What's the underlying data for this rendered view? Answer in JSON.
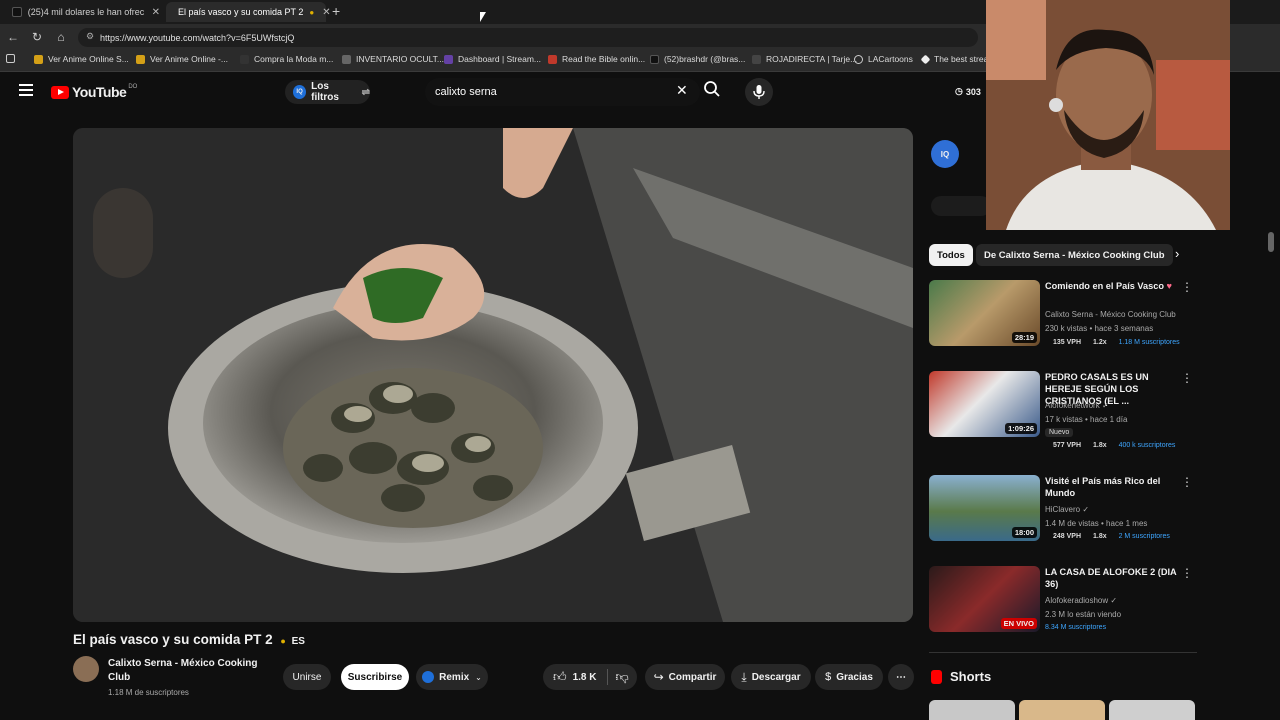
{
  "browser": {
    "tabs": [
      {
        "label": "(25)4 mil dolares le han ofrecido",
        "active": false
      },
      {
        "label": "El país vasco y su comida PT 2",
        "active": true
      }
    ],
    "url": "https://www.youtube.com/watch?v=6F5UWfstcjQ",
    "bookmarks": [
      "Ver Anime Online S...",
      "Ver Anime Online -...",
      "Compra la Moda m...",
      "INVENTARIO OCULT...",
      "Dashboard | Stream...",
      "Read the Bible onlin...",
      "(52)brashdr (@bras...",
      "ROJADIRECTA | Tarje...",
      "LACartoons",
      "The best strea"
    ]
  },
  "youtube": {
    "logo_text": "YouTube",
    "logo_sup": "DO",
    "filters_label": "Los filtros",
    "search_value": "calixto serna",
    "counter": "303"
  },
  "video": {
    "title": "El país vasco y su comida PT 2",
    "lang": "ES",
    "channel": "Calixto Serna - México Cooking Club",
    "subscribers": "1.18 M de suscriptores",
    "join_label": "Unirse",
    "subscribe_label": "Suscribirse",
    "remix_label": "Remix",
    "likes": "1.8 K",
    "share_label": "Compartir",
    "download_label": "Descargar",
    "thanks_label": "Gracias"
  },
  "sidebar": {
    "chips": [
      "Todos",
      "De Calixto Serna - México Cooking Club"
    ],
    "cards": [
      {
        "title": "Comiendo en el País Vasco",
        "channel": "Calixto Serna - México Cooking Club",
        "views": "230 k vistas • hace 3 semanas",
        "duration": "28:19",
        "vph": "135 VPH",
        "mult": "1.2x",
        "subs": "1.18 M suscriptores",
        "badge": ""
      },
      {
        "title": "PEDRO CASALS ES UN HEREJE SEGÚN LOS CRISTIANOS (EL ...",
        "channel": "Alofokenetwork",
        "views": "17 k vistas • hace 1 día",
        "duration": "1:09:26",
        "vph": "577 VPH",
        "mult": "1.8x",
        "subs": "400 k suscriptores",
        "badge": "Nuevo"
      },
      {
        "title": "Visité el País más Rico del Mundo",
        "channel": "HiClavero",
        "views": "1.4 M de vistas • hace 1 mes",
        "duration": "18:00",
        "vph": "248 VPH",
        "mult": "1.8x",
        "subs": "2 M suscriptores",
        "badge": ""
      },
      {
        "title": "LA CASA DE ALOFOKE 2 (DIA 36)",
        "channel": "Alofokeradioshow",
        "views": "2.3 M lo están viendo",
        "duration": "EN VIVO",
        "vph": "",
        "mult": "",
        "subs": "8.34 M suscriptores",
        "badge": ""
      }
    ],
    "shorts_label": "Shorts"
  }
}
